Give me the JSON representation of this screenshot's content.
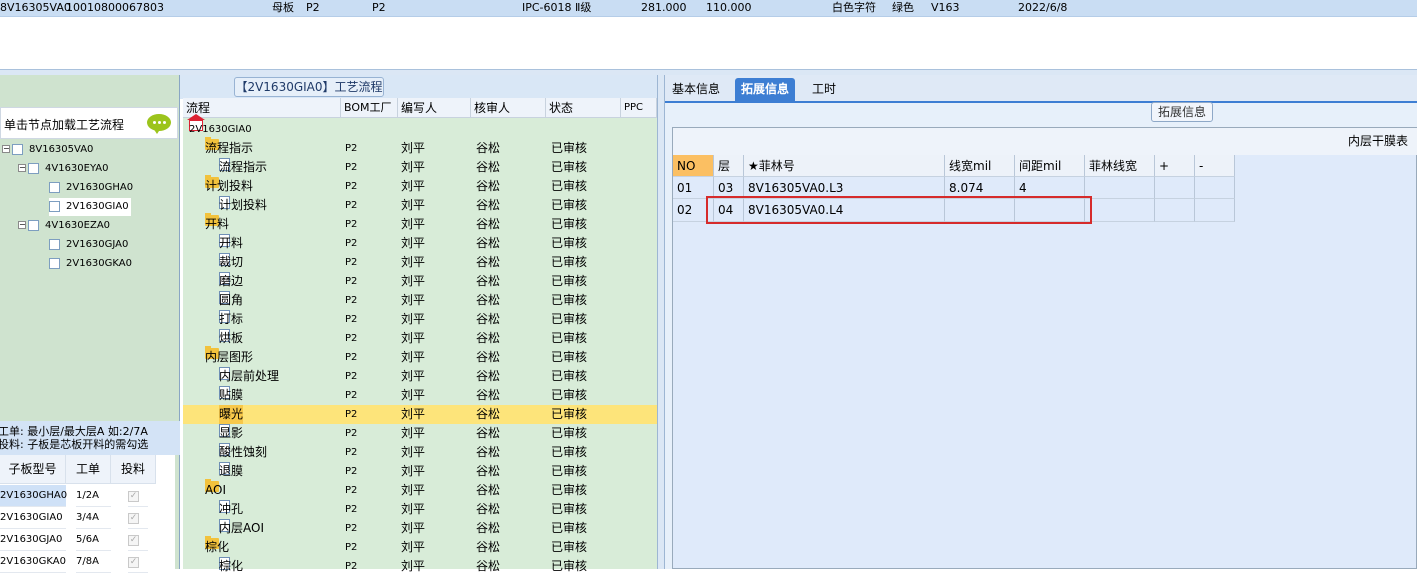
{
  "top_row": {
    "cells": [
      "8V16305VA0",
      "10010800067803",
      "母板",
      "P2",
      "P2",
      "IPC-6018 Ⅱ级",
      "281.000",
      "110.000",
      "白色字符",
      "绿色",
      "V163",
      "2022/6/8"
    ]
  },
  "left_panel": {
    "hint": "单击节点加载工艺流程",
    "tree": [
      "8V16305VA0",
      "4V1630EYA0",
      "2V1630GHA0",
      "2V1630GIA0",
      "4V1630EZA0",
      "2V1630GJA0",
      "2V1630GKA0"
    ],
    "info_line1": "工单: 最小层/最大层A 如:2/7A",
    "info_line2": "投料: 子板是芯板开料的需勾选",
    "sub_headers": [
      "子板型号",
      "工单",
      "投料"
    ],
    "sub_rows": [
      {
        "model": "2V1630GHA0",
        "order": "1/2A",
        "check": "✓"
      },
      {
        "model": "2V1630GIA0",
        "order": "3/4A",
        "check": "✓"
      },
      {
        "model": "2V1630GJA0",
        "order": "5/6A",
        "check": "✓"
      },
      {
        "model": "2V1630GKA0",
        "order": "7/8A",
        "check": "✓"
      }
    ]
  },
  "middle_panel": {
    "title": "【2V1630GIA0】工艺流程",
    "headers": [
      "流程",
      "BOM工厂",
      "编写人",
      "核审人",
      "状态",
      "PPC"
    ],
    "root": "2V1630GIA0",
    "rows": [
      {
        "name": "流程指示",
        "bom": "P2",
        "writer": "刘平",
        "reviewer": "谷松",
        "status": "已审核"
      },
      {
        "name": "流程指示",
        "bom": "P2",
        "writer": "刘平",
        "reviewer": "谷松",
        "status": "已审核"
      },
      {
        "name": "计划投料",
        "bom": "P2",
        "writer": "刘平",
        "reviewer": "谷松",
        "status": "已审核"
      },
      {
        "name": "计划投料",
        "bom": "P2",
        "writer": "刘平",
        "reviewer": "谷松",
        "status": "已审核"
      },
      {
        "name": "开料",
        "bom": "P2",
        "writer": "刘平",
        "reviewer": "谷松",
        "status": "已审核"
      },
      {
        "name": "开料",
        "bom": "P2",
        "writer": "刘平",
        "reviewer": "谷松",
        "status": "已审核"
      },
      {
        "name": "裁切",
        "bom": "P2",
        "writer": "刘平",
        "reviewer": "谷松",
        "status": "已审核"
      },
      {
        "name": "磨边",
        "bom": "P2",
        "writer": "刘平",
        "reviewer": "谷松",
        "status": "已审核"
      },
      {
        "name": "圆角",
        "bom": "P2",
        "writer": "刘平",
        "reviewer": "谷松",
        "status": "已审核"
      },
      {
        "name": "打标",
        "bom": "P2",
        "writer": "刘平",
        "reviewer": "谷松",
        "status": "已审核"
      },
      {
        "name": "烘板",
        "bom": "P2",
        "writer": "刘平",
        "reviewer": "谷松",
        "status": "已审核"
      },
      {
        "name": "内层图形",
        "bom": "P2",
        "writer": "刘平",
        "reviewer": "谷松",
        "status": "已审核"
      },
      {
        "name": "内层前处理",
        "bom": "P2",
        "writer": "刘平",
        "reviewer": "谷松",
        "status": "已审核"
      },
      {
        "name": "贴膜",
        "bom": "P2",
        "writer": "刘平",
        "reviewer": "谷松",
        "status": "已审核"
      },
      {
        "name": "曝光",
        "bom": "P2",
        "writer": "刘平",
        "reviewer": "谷松",
        "status": "已审核"
      },
      {
        "name": "显影",
        "bom": "P2",
        "writer": "刘平",
        "reviewer": "谷松",
        "status": "已审核"
      },
      {
        "name": "酸性蚀刻",
        "bom": "P2",
        "writer": "刘平",
        "reviewer": "谷松",
        "status": "已审核"
      },
      {
        "name": "退膜",
        "bom": "P2",
        "writer": "刘平",
        "reviewer": "谷松",
        "status": "已审核"
      },
      {
        "name": "AOI",
        "bom": "P2",
        "writer": "刘平",
        "reviewer": "谷松",
        "status": "已审核"
      },
      {
        "name": "冲孔",
        "bom": "P2",
        "writer": "刘平",
        "reviewer": "谷松",
        "status": "已审核"
      },
      {
        "name": "内层AOI",
        "bom": "P2",
        "writer": "刘平",
        "reviewer": "谷松",
        "status": "已审核"
      },
      {
        "name": "棕化",
        "bom": "P2",
        "writer": "刘平",
        "reviewer": "谷松",
        "status": "已审核"
      },
      {
        "name": "棕化",
        "bom": "P2",
        "writer": "刘平",
        "reviewer": "谷松",
        "status": "已审核"
      }
    ]
  },
  "right_panel": {
    "tabs": [
      "基本信息",
      "拓展信息",
      "工时"
    ],
    "section_title": "拓展信息",
    "grid_title": "内层干膜表",
    "headers": [
      "NO",
      "层",
      "★菲林号",
      "线宽mil",
      "间距mil",
      "菲林线宽",
      "+",
      "-"
    ],
    "rows": [
      {
        "no": "01",
        "layer": "03",
        "film": "8V16305VA0.L3",
        "width": "8.074",
        "spacing": "4",
        "film_width": ""
      },
      {
        "no": "02",
        "layer": "04",
        "film": "8V16305VA0.L4",
        "width": "",
        "spacing": "",
        "film_width": ""
      }
    ]
  }
}
